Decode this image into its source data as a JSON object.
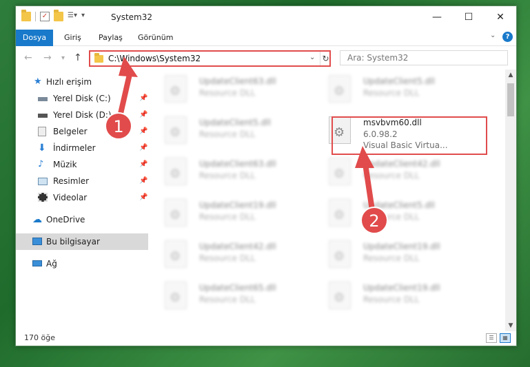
{
  "window": {
    "title": "System32"
  },
  "ribbon": {
    "tabs": [
      "Dosya",
      "Giriş",
      "Paylaş",
      "Görünüm"
    ],
    "help": "?"
  },
  "address": {
    "path": "C:\\Windows\\System32"
  },
  "search": {
    "placeholder": "Ara: System32"
  },
  "nav": {
    "items": [
      {
        "label": "Hızlı erişim",
        "icon": "star-icon"
      },
      {
        "label": "Yerel Disk (C:)",
        "icon": "drive-icon"
      },
      {
        "label": "Yerel Disk (D:)",
        "icon": "drive-icon"
      },
      {
        "label": "Belgeler",
        "icon": "documents-icon"
      },
      {
        "label": "İndirmeler",
        "icon": "download-icon"
      },
      {
        "label": "Müzik",
        "icon": "music-icon"
      },
      {
        "label": "Resimler",
        "icon": "pictures-icon"
      },
      {
        "label": "Videolar",
        "icon": "video-icon"
      },
      {
        "label": "OneDrive",
        "icon": "cloud-icon"
      },
      {
        "label": "Bu bilgisayar",
        "icon": "computer-icon"
      },
      {
        "label": "Ağ",
        "icon": "network-icon"
      }
    ]
  },
  "files": {
    "left": [
      {
        "name": "UpdateClient63.dll",
        "desc": "Resource DLL"
      },
      {
        "name": "UpdateClient5.dll",
        "desc": "Resource DLL"
      },
      {
        "name": "UpdateClient63.dll",
        "desc": "Resource DLL"
      },
      {
        "name": "UpdateClient19.dll",
        "desc": "Resource DLL"
      },
      {
        "name": "UpdateClient42.dll",
        "desc": "Resource DLL"
      },
      {
        "name": "UpdateClient65.dll",
        "desc": "Resource DLL"
      }
    ],
    "right": [
      {
        "name": "UpdateClient5.dll",
        "desc": "Resource DLL"
      },
      {
        "name": "UpdateClient42.dll",
        "desc": "Resource DLL"
      },
      {
        "name": "UpdateClient5.dll",
        "desc": "Resource DLL"
      },
      {
        "name": "UpdateClient19.dll",
        "desc": "Resource DLL"
      },
      {
        "name": "UpdateClient19.dll",
        "desc": "Resource DLL"
      }
    ],
    "featured": {
      "name": "msvbvm60.dll",
      "version": "6.0.98.2",
      "desc": "Visual Basic Virtua..."
    }
  },
  "status": {
    "count": "170 öğe"
  },
  "annotations": {
    "step1": "1",
    "step2": "2",
    "color": "#e14b4b"
  }
}
